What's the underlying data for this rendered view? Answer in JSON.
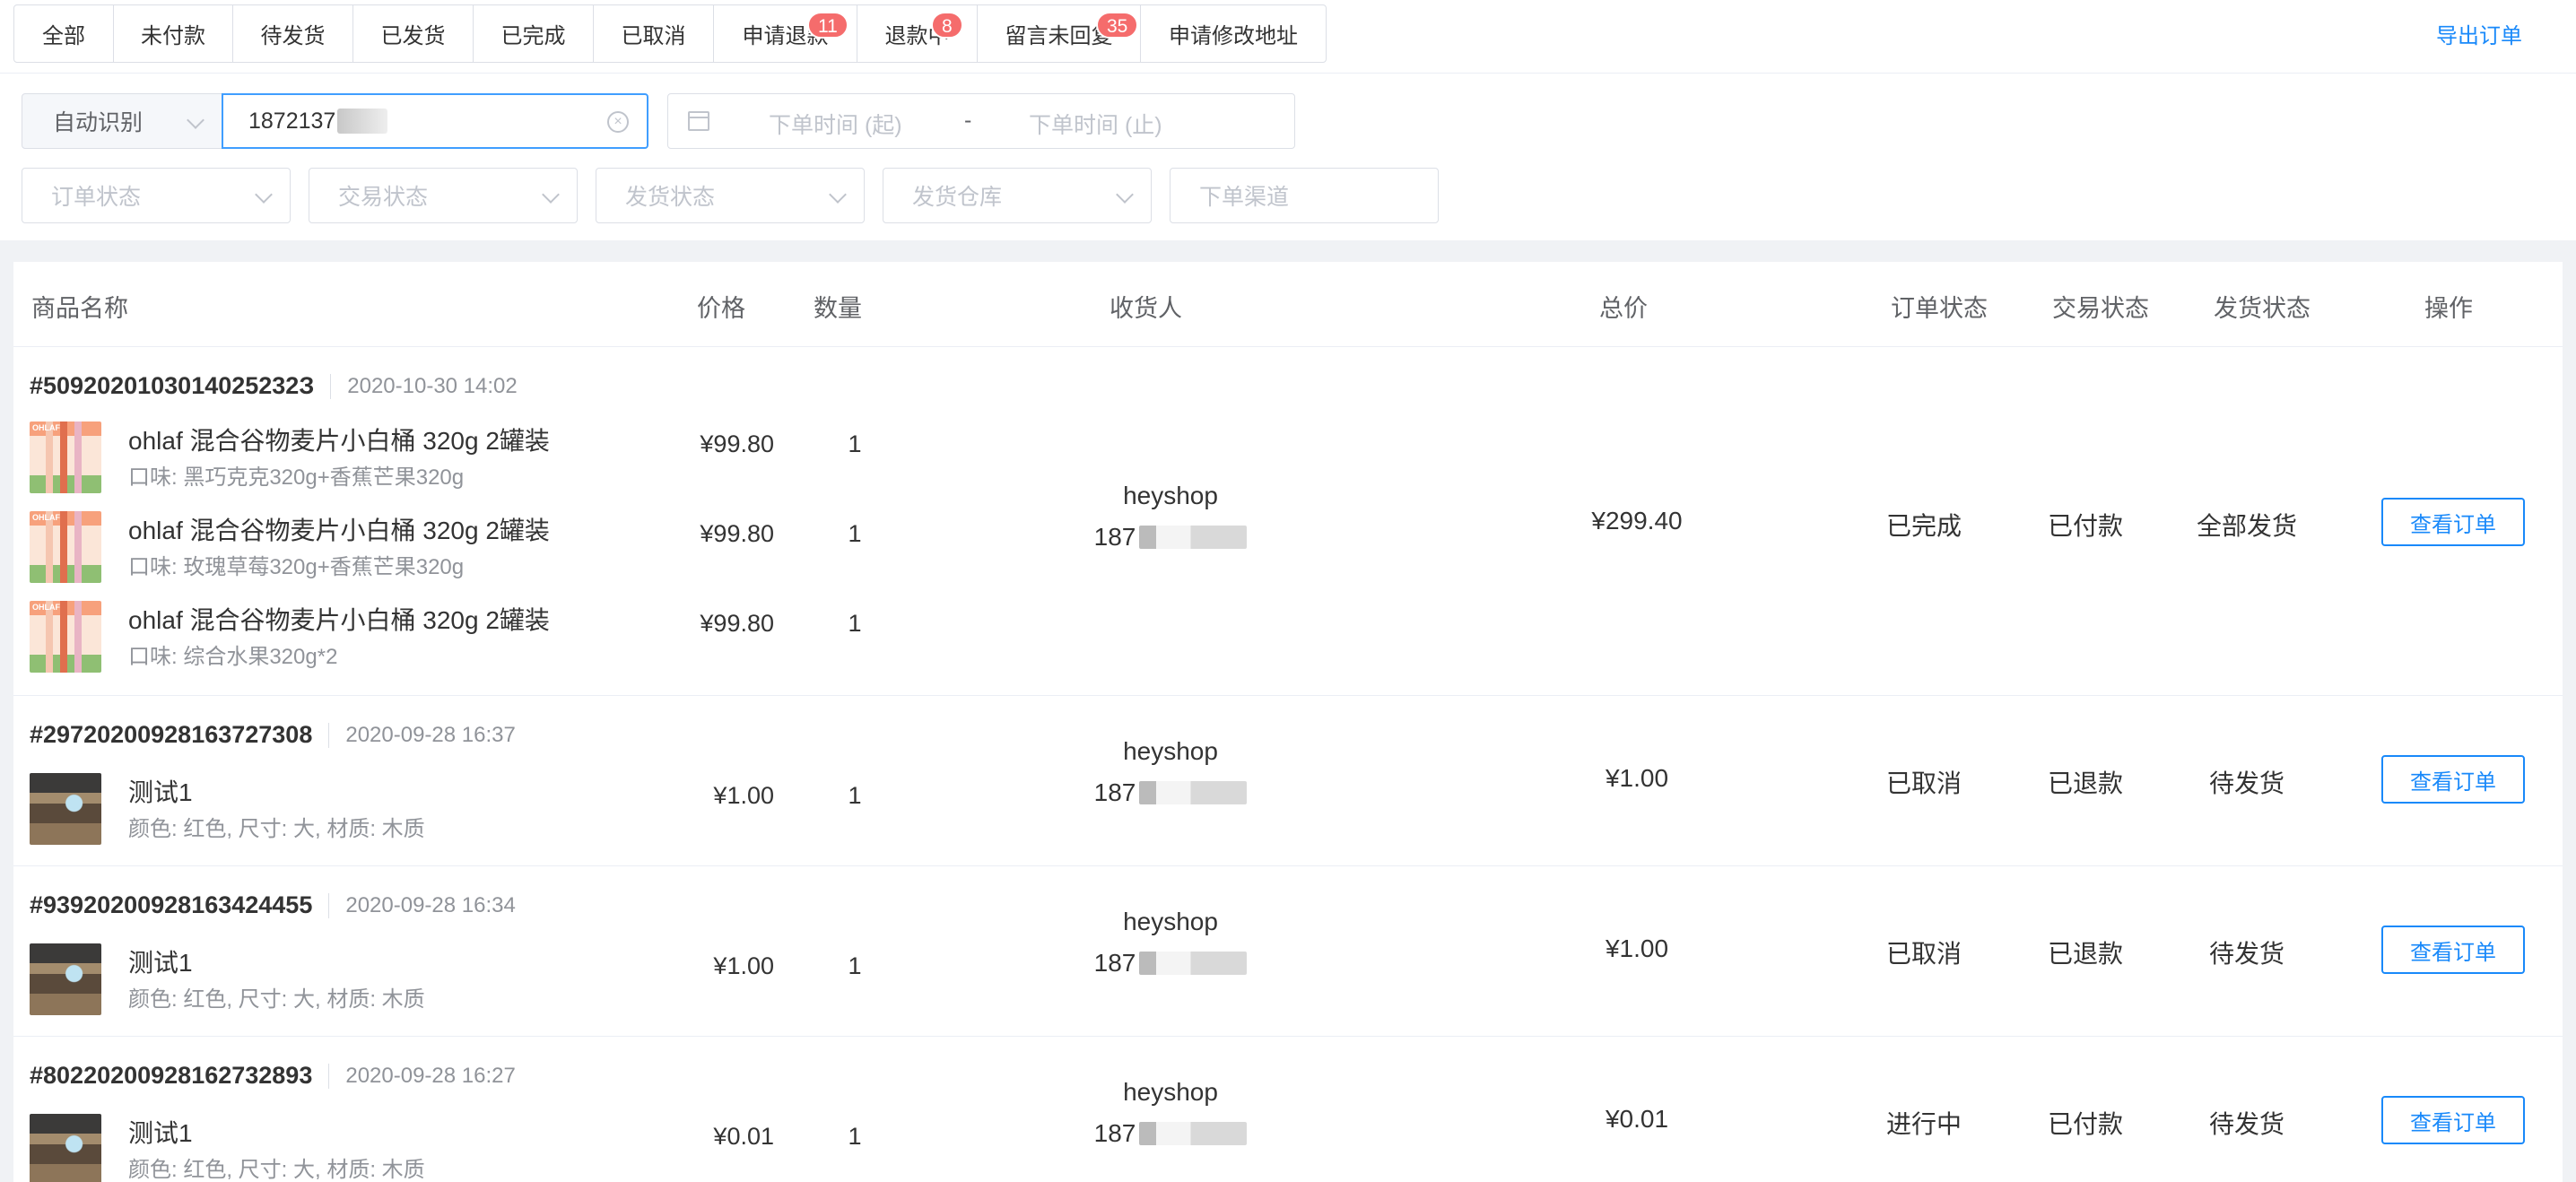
{
  "tabs": [
    {
      "label": "全部",
      "badge": ""
    },
    {
      "label": "未付款",
      "badge": ""
    },
    {
      "label": "待发货",
      "badge": ""
    },
    {
      "label": "已发货",
      "badge": ""
    },
    {
      "label": "已完成",
      "badge": ""
    },
    {
      "label": "已取消",
      "badge": ""
    },
    {
      "label": "申请退款",
      "badge": "11"
    },
    {
      "label": "退款中",
      "badge": "8"
    },
    {
      "label": "留言未回复",
      "badge": "35"
    },
    {
      "label": "申请修改地址",
      "badge": ""
    }
  ],
  "export_label": "导出订单",
  "filters": {
    "ident_select": "自动识别",
    "search_value": "1872137",
    "date_start_placeholder": "下单时间 (起)",
    "date_separator": "-",
    "date_end_placeholder": "下单时间 (止)",
    "order_status": "订单状态",
    "trade_status": "交易状态",
    "ship_status": "发货状态",
    "warehouse": "发货仓库",
    "channel": "下单渠道"
  },
  "table": {
    "columns": {
      "product": "商品名称",
      "price": "价格",
      "qty": "数量",
      "receiver": "收货人",
      "total": "总价",
      "order_status": "订单状态",
      "trade_status": "交易状态",
      "ship_status": "发货状态",
      "action": "操作"
    },
    "view_button": "查看订单",
    "orders": [
      {
        "order_no": "#5092020103014025232З",
        "time": "2020-10-30 14:02",
        "items": [
          {
            "name": "ohlaf 混合谷物麦片小白桶 320g 2罐装",
            "spec": "口味: 黑巧克克320g+香蕉芒果320g",
            "price": "¥99.80",
            "qty": "1"
          },
          {
            "name": "ohlaf 混合谷物麦片小白桶 320g 2罐装",
            "spec": "口味: 玫瑰草莓320g+香蕉芒果320g",
            "price": "¥99.80",
            "qty": "1"
          },
          {
            "name": "ohlaf 混合谷物麦片小白桶 320g 2罐装",
            "spec": "口味: 综合水果320g*2",
            "price": "¥99.80",
            "qty": "1"
          }
        ],
        "receiver": "heyshop",
        "phone_prefix": "187",
        "total": "¥299.40",
        "order_status": "已完成",
        "trade_status": "已付款",
        "ship_status": "全部发货"
      },
      {
        "order_no": "#29720200928163727308",
        "time": "2020-09-28 16:37",
        "items": [
          {
            "name": "测试1",
            "spec": "颜色: 红色, 尺寸: 大, 材质: 木质",
            "price": "¥1.00",
            "qty": "1"
          }
        ],
        "receiver": "heyshop",
        "phone_prefix": "187",
        "total": "¥1.00",
        "order_status": "已取消",
        "trade_status": "已退款",
        "ship_status": "待发货"
      },
      {
        "order_no": "#93920200928163424455",
        "time": "2020-09-28 16:34",
        "items": [
          {
            "name": "测试1",
            "spec": "颜色: 红色, 尺寸: 大, 材质: 木质",
            "price": "¥1.00",
            "qty": "1"
          }
        ],
        "receiver": "heyshop",
        "phone_prefix": "187",
        "total": "¥1.00",
        "order_status": "已取消",
        "trade_status": "已退款",
        "ship_status": "待发货"
      },
      {
        "order_no": "#80220200928162732893",
        "time": "2020-09-28 16:27",
        "items": [
          {
            "name": "测试1",
            "spec": "颜色: 红色, 尺寸: 大, 材质: 木质",
            "price": "¥0.01",
            "qty": "1"
          }
        ],
        "receiver": "heyshop",
        "phone_prefix": "187",
        "total": "¥0.01",
        "order_status": "进行中",
        "trade_status": "已付款",
        "ship_status": "待发货"
      }
    ]
  }
}
